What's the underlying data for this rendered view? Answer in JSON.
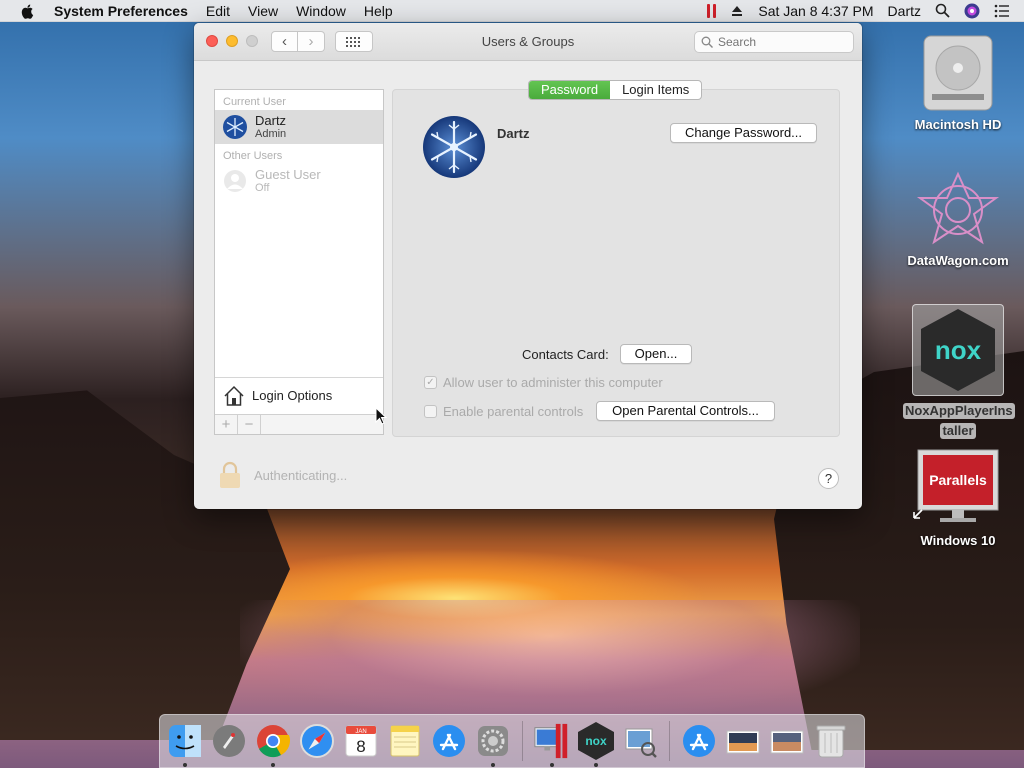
{
  "menubar": {
    "app_name": "System Preferences",
    "menus": [
      "Edit",
      "View",
      "Window",
      "Help"
    ],
    "datetime": "Sat Jan 8  4:37 PM",
    "user": "Dartz"
  },
  "window": {
    "title": "Users & Groups",
    "search_placeholder": "Search",
    "tabs": {
      "password": "Password",
      "login_items": "Login Items",
      "active": "Password"
    }
  },
  "userlist": {
    "current_header": "Current User",
    "current_user": {
      "name": "Dartz",
      "role": "Admin"
    },
    "other_header": "Other Users",
    "guest_user": {
      "name": "Guest User",
      "role": "Off"
    },
    "login_options": "Login Options"
  },
  "detail": {
    "name": "Dartz",
    "change_password": "Change Password...",
    "contacts_label": "Contacts Card:",
    "open_button": "Open...",
    "allow_admin": "Allow user to administer this computer",
    "allow_admin_checked": true,
    "parental": "Enable parental controls",
    "parental_checked": false,
    "open_parental": "Open Parental Controls..."
  },
  "footer": {
    "auth": "Authenticating...",
    "help": "?"
  },
  "desktop": {
    "icons": [
      {
        "label": "Macintosh HD"
      },
      {
        "label": "DataWagon.com"
      },
      {
        "label": "NoxAppPlayerInstaller",
        "line1": "NoxAppPlayerIns",
        "line2": "taller"
      },
      {
        "label": "Windows 10",
        "badge": "Parallels"
      }
    ]
  },
  "dock": {
    "items": [
      "finder-icon",
      "launchpad-icon",
      "chrome-icon",
      "safari-icon",
      "calendar-icon",
      "notes-icon",
      "app-store-icon",
      "system-preferences-icon",
      "parallels-icon",
      "nox-icon",
      "preview-icon",
      "app-store-download-icon",
      "photo-icon",
      "photo-icon-2",
      "trash-icon"
    ],
    "calendar": {
      "month": "JAN",
      "day": "8"
    }
  },
  "colors": {
    "accent_green": "#4aab3c",
    "close": "#fc5f57",
    "minimize": "#fdbc2e"
  }
}
